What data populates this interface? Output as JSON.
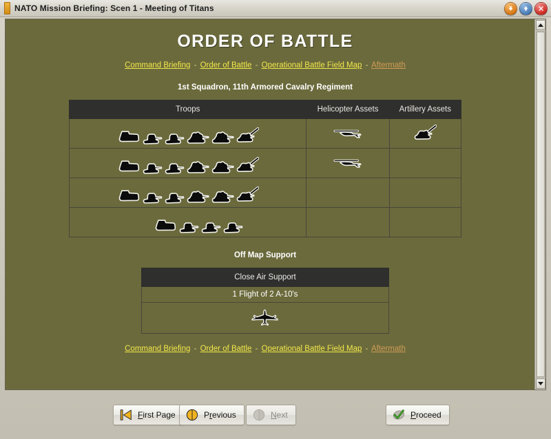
{
  "window": {
    "title": "NATO Mission Briefing: Scen 1 - Meeting of Titans",
    "buttons": {
      "minimize": "minimize-button",
      "maximize": "maximize-button",
      "close": "close-button"
    }
  },
  "page": {
    "heading": "ORDER OF BATTLE",
    "nav": {
      "links": [
        {
          "label": "Command Briefing",
          "state": "active"
        },
        {
          "label": "Order of Battle",
          "state": "active"
        },
        {
          "label": "Operational Battle Field Map",
          "state": "active"
        },
        {
          "label": "Aftermath",
          "state": "muted"
        }
      ],
      "separator": "-"
    },
    "unit_title": "1st Squadron, 11th Armored Cavalry Regiment",
    "oob_table": {
      "columns": [
        "Troops",
        "Helicopter Assets",
        "Artillery Assets"
      ],
      "rows": [
        {
          "troops": [
            "apc",
            "tank-small",
            "tank-small",
            "tank",
            "tank",
            "spg"
          ],
          "helicopters": [
            "helicopter"
          ],
          "artillery": [
            "spg"
          ]
        },
        {
          "troops": [
            "apc",
            "tank-small",
            "tank-small",
            "tank",
            "tank",
            "spg"
          ],
          "helicopters": [
            "helicopter"
          ],
          "artillery": []
        },
        {
          "troops": [
            "apc",
            "tank-small",
            "tank-small",
            "tank",
            "tank",
            "spg"
          ],
          "helicopters": [],
          "artillery": []
        },
        {
          "troops": [
            "apc",
            "tank-small",
            "tank-small",
            "tank-small"
          ],
          "helicopters": [],
          "artillery": []
        }
      ]
    },
    "offmap_label": "Off Map Support",
    "offmap_table": {
      "header": "Close Air Support",
      "detail": "1 Flight of 2 A-10's",
      "icon": "jet-aircraft"
    }
  },
  "footer_buttons": [
    {
      "id": "first-page",
      "label_pre": "",
      "label_key": "F",
      "label_post": "irst Page",
      "icon": "first-page-icon",
      "disabled": false
    },
    {
      "id": "previous",
      "label_pre": "P",
      "label_key": "r",
      "label_post": "evious",
      "icon": "previous-icon",
      "disabled": false
    },
    {
      "id": "next",
      "label_pre": "",
      "label_key": "N",
      "label_post": "ext",
      "icon": "next-icon",
      "disabled": true
    },
    {
      "id": "proceed",
      "label_pre": "",
      "label_key": "P",
      "label_post": "roceed",
      "icon": "proceed-check-icon",
      "disabled": false
    }
  ],
  "colors": {
    "page_bg": "#6b6a3c",
    "table_header_bg": "#2f2f2d",
    "link": "#f2e84a",
    "link_muted": "#cf9c55",
    "accent_orange": "#e9a020",
    "proceed_green": "#3f8f2a"
  },
  "scrollbar": {
    "position": "top"
  }
}
